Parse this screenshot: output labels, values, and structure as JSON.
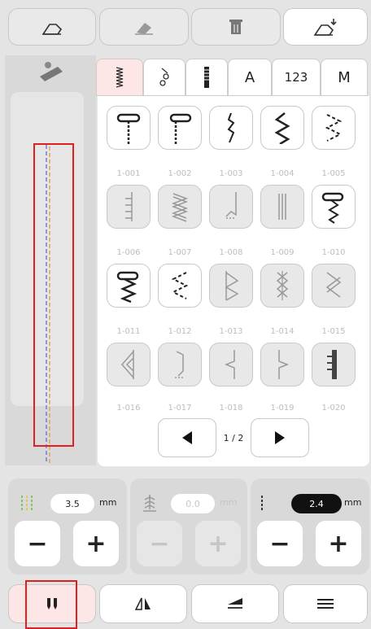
{
  "top_toolbar": {
    "icons": [
      "eraser-outline-icon",
      "eraser-icon",
      "trash-icon",
      "eraser-export-icon"
    ]
  },
  "tabs": [
    {
      "label": "",
      "icon": "straight-stitch-tab-icon"
    },
    {
      "label": "",
      "icon": "decorative-stitch-tab-icon"
    },
    {
      "label": "",
      "icon": "buttonhole-tab-icon"
    },
    {
      "label": "A"
    },
    {
      "label": "123"
    },
    {
      "label": "M"
    }
  ],
  "stitches": [
    {
      "code": "1-001",
      "style": "white"
    },
    {
      "code": "1-002",
      "style": "white"
    },
    {
      "code": "1-003",
      "style": "white"
    },
    {
      "code": "1-004",
      "style": "white"
    },
    {
      "code": "1-005",
      "style": "white"
    },
    {
      "code": "1-006",
      "style": "grey"
    },
    {
      "code": "1-007",
      "style": "grey"
    },
    {
      "code": "1-008",
      "style": "grey"
    },
    {
      "code": "1-009",
      "style": "grey"
    },
    {
      "code": "1-010",
      "style": "white"
    },
    {
      "code": "1-011",
      "style": "white"
    },
    {
      "code": "1-012",
      "style": "white"
    },
    {
      "code": "1-013",
      "style": "grey"
    },
    {
      "code": "1-014",
      "style": "grey"
    },
    {
      "code": "1-015",
      "style": "grey"
    },
    {
      "code": "1-016",
      "style": "grey"
    },
    {
      "code": "1-017",
      "style": "grey"
    },
    {
      "code": "1-018",
      "style": "grey"
    },
    {
      "code": "1-019",
      "style": "grey"
    },
    {
      "code": "1-020",
      "style": "grey"
    }
  ],
  "pager": {
    "label": "1 / 2"
  },
  "controls": {
    "width": {
      "value": "3.5",
      "unit": "mm"
    },
    "tension": {
      "value": "0.0",
      "unit": "mm"
    },
    "length": {
      "value": "2.4",
      "unit": "mm"
    }
  },
  "bottom_bar": {
    "icons": [
      "twin-needle-icon",
      "mirror-icon",
      "direction-icon",
      "menu-icon"
    ]
  },
  "colors": {
    "accent_red": "#e02020",
    "active_tab": "#fde6e6",
    "dark_value": "#111111"
  }
}
